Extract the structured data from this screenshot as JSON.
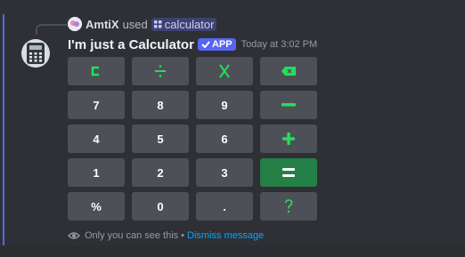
{
  "reply": {
    "username": "AmtiX",
    "used_text": "used",
    "command": "calculator"
  },
  "message": {
    "author": "I'm just a Calculator",
    "app_badge": "APP",
    "timestamp": "Today at 3:02 PM"
  },
  "calculator": {
    "rows": [
      [
        {
          "label": "C",
          "icon": "clear-icon"
        },
        {
          "label": "÷",
          "icon": "divide-icon"
        },
        {
          "label": "X",
          "icon": "multiply-icon"
        },
        {
          "label": "⌫",
          "icon": "backspace-icon"
        }
      ],
      [
        {
          "label": "7"
        },
        {
          "label": "8"
        },
        {
          "label": "9"
        },
        {
          "label": "−",
          "icon": "minus-icon"
        }
      ],
      [
        {
          "label": "4"
        },
        {
          "label": "5"
        },
        {
          "label": "6"
        },
        {
          "label": "+",
          "icon": "plus-icon"
        }
      ],
      [
        {
          "label": "1"
        },
        {
          "label": "2"
        },
        {
          "label": "3"
        },
        {
          "label": "=",
          "icon": "equals-icon"
        }
      ],
      [
        {
          "label": "%"
        },
        {
          "label": "0"
        },
        {
          "label": "."
        },
        {
          "label": "?",
          "icon": "question-icon"
        }
      ]
    ],
    "accent_green": "#23e05a",
    "equals_bg": "#248046",
    "button_bg": "#4e5058"
  },
  "footer": {
    "text": "Only you can see this",
    "separator": "•",
    "dismiss_label": "Dismiss message"
  }
}
